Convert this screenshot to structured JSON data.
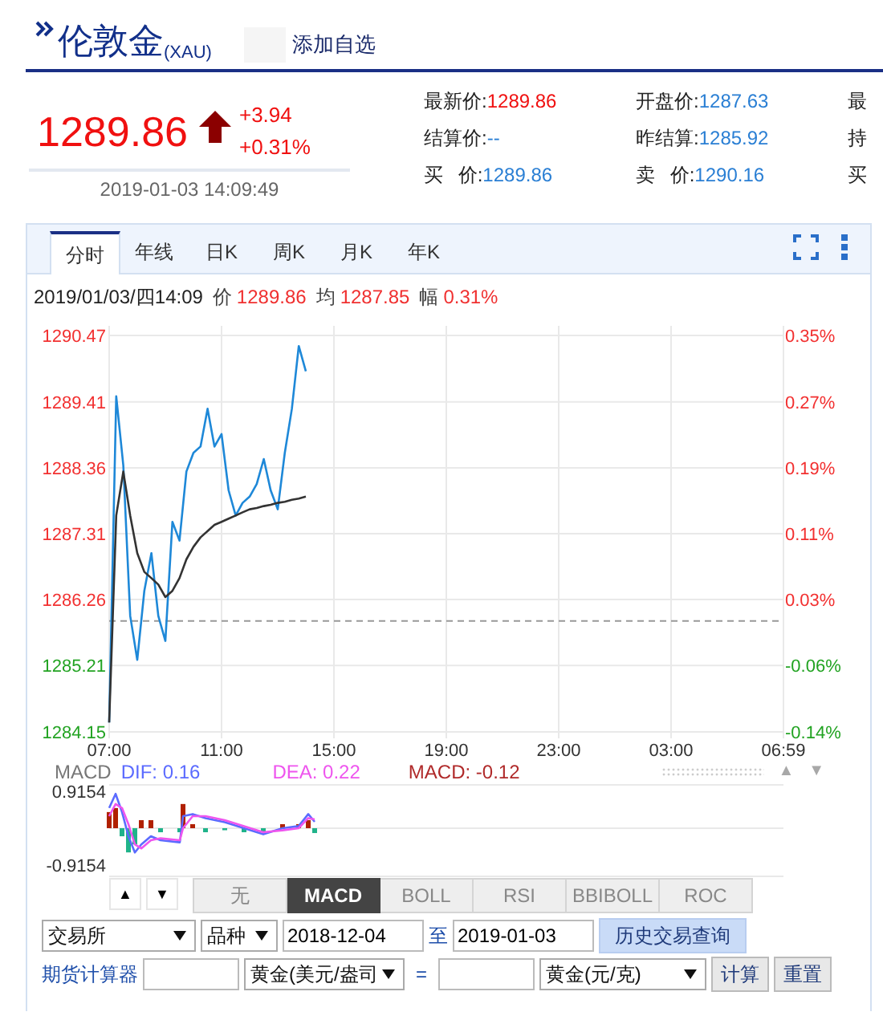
{
  "header": {
    "title": "伦敦金",
    "code": "(XAU)",
    "watch_button": "添加自选"
  },
  "price": {
    "value": "1289.86",
    "rising": true,
    "change": "+3.94",
    "change_pct": "+0.31%",
    "time": "2019-01-03 14:09:49"
  },
  "quotes": [
    [
      {
        "label": "最新价:",
        "value": "1289.86",
        "highlight": true
      },
      {
        "label": "开盘价:",
        "value": "1287.63",
        "highlight": false
      },
      {
        "label": "最"
      }
    ],
    [
      {
        "label": "结算价:",
        "value": "--",
        "highlight": false
      },
      {
        "label": "昨结算:",
        "value": "1285.92",
        "highlight": false
      },
      {
        "label": "持"
      }
    ],
    [
      {
        "label": "买 价:",
        "value": "1289.86",
        "highlight": false
      },
      {
        "label": "卖 价:",
        "value": "1290.16",
        "highlight": false
      },
      {
        "label": "买"
      }
    ]
  ],
  "chart_panel": {
    "tabs": [
      {
        "label": "分时",
        "selected": true
      },
      {
        "label": "年线",
        "selected": false
      },
      {
        "label": "日K",
        "selected": false
      },
      {
        "label": "周K",
        "selected": false
      },
      {
        "label": "月K",
        "selected": false
      },
      {
        "label": "年K",
        "selected": false
      }
    ],
    "info": {
      "time": "2019/01/03/四14:09",
      "items": [
        {
          "label": "价",
          "value": "1289.86"
        },
        {
          "label": "均",
          "value": "1287.85"
        },
        {
          "label": "幅",
          "value": "0.31%"
        }
      ]
    },
    "chart_data": {
      "type": "line",
      "categories": [
        "07:00",
        null,
        null,
        null,
        null,
        null,
        null,
        null,
        null,
        null,
        null,
        null,
        null,
        null,
        null,
        null,
        "11:00",
        null,
        null,
        null,
        null,
        null,
        null,
        null,
        null,
        null,
        null,
        null,
        null,
        null,
        null,
        null,
        "15:00",
        null,
        null,
        null,
        null,
        null,
        null,
        null,
        null,
        null,
        null,
        null,
        null,
        null,
        null,
        null,
        "19:00",
        null,
        null,
        null,
        null,
        null,
        null,
        null,
        null,
        null,
        null,
        null,
        null,
        null,
        null,
        null,
        "23:00",
        null,
        null,
        null,
        null,
        null,
        null,
        null,
        null,
        null,
        null,
        null,
        null,
        null,
        null,
        null,
        "03:00",
        null,
        null,
        null,
        null,
        null,
        null,
        null,
        null,
        null,
        null,
        null,
        null,
        null,
        null,
        null,
        "06:59"
      ],
      "series": [
        {
          "color": "#1e88d8",
          "values": [
            1284.3,
            1289.5,
            1288.4,
            1286.0,
            1285.3,
            1286.4,
            1287.0,
            1286.0,
            1285.6,
            1287.5,
            1287.2,
            1288.3,
            1288.6,
            1288.7,
            1289.3,
            1288.7,
            1288.9,
            1288.0,
            1287.6,
            1287.8,
            1287.9,
            1288.1,
            1288.5,
            1288.0,
            1287.7,
            1288.6,
            1289.3,
            1290.3,
            1289.9,
            null,
            null,
            null,
            null,
            null,
            null,
            null,
            null,
            null,
            null,
            null,
            null,
            null,
            null,
            null,
            null,
            null,
            null,
            null,
            null,
            null,
            null,
            null,
            null,
            null,
            null,
            null,
            null,
            null,
            null,
            null,
            null,
            null,
            null,
            null,
            null,
            null,
            null,
            null,
            null,
            null,
            null,
            null,
            null,
            null,
            null,
            null,
            null,
            null,
            null,
            null,
            null,
            null,
            null,
            null,
            null,
            null,
            null,
            null,
            null,
            null,
            null,
            null,
            null,
            null,
            null,
            null,
            null
          ]
        },
        {
          "color": "#333333",
          "values": [
            1284.3,
            1287.6,
            1288.3,
            1287.6,
            1287.0,
            1286.7,
            1286.6,
            1286.5,
            1286.3,
            1286.4,
            1286.6,
            1286.9,
            1287.1,
            1287.25,
            1287.35,
            1287.45,
            1287.5,
            1287.55,
            1287.6,
            1287.65,
            1287.7,
            1287.72,
            1287.75,
            1287.77,
            1287.8,
            1287.82,
            1287.85,
            1287.87,
            1287.9,
            null,
            null,
            null,
            null,
            null,
            null,
            null,
            null,
            null,
            null,
            null,
            null,
            null,
            null,
            null,
            null,
            null,
            null,
            null,
            null,
            null,
            null,
            null,
            null,
            null,
            null,
            null,
            null,
            null,
            null,
            null,
            null,
            null,
            null,
            null,
            null,
            null,
            null,
            null,
            null,
            null,
            null,
            null,
            null,
            null,
            null,
            null,
            null,
            null,
            null,
            null,
            null,
            null,
            null,
            null,
            null,
            null,
            null,
            null,
            null,
            null,
            null,
            null,
            null,
            null,
            null,
            null,
            null
          ]
        }
      ],
      "grid": true,
      "ylim": [
        1284.15,
        1290.47
      ],
      "y2lim": [
        -0.1376,
        0.3538
      ],
      "yticks": [
        1284.15,
        1285.21,
        1286.26,
        1287.31,
        1288.36,
        1289.41,
        1290.47
      ],
      "y2ticks": [
        {
          "value": -0.1376,
          "label": "-0.14%"
        },
        {
          "value": -0.0552,
          "label": "-0.06%"
        },
        {
          "value": 0.0264,
          "label": "0.03%"
        },
        {
          "value": 0.1081,
          "label": "0.11%"
        },
        {
          "value": 0.1897,
          "label": "0.19%"
        },
        {
          "value": 0.2714,
          "label": "0.27%"
        },
        {
          "value": 0.3538,
          "label": "0.35%"
        }
      ],
      "ref_lines": [
        {
          "axis": "y",
          "value": 1285.92
        }
      ]
    },
    "macd": {
      "title": "MACD",
      "legend": [
        {
          "text": "DIF: 0.16",
          "color": "#5b6bff"
        },
        {
          "text": "DEA: 0.22",
          "color": "#ee55ee"
        },
        {
          "text": "MACD: -0.12",
          "color": "#b02a2a"
        }
      ],
      "arrows": [
        {
          "text": "▲",
          "disabled": true
        },
        {
          "text": "▼",
          "disabled": true
        }
      ],
      "scale_labels": [
        "0.9154",
        "-0.9154"
      ]
    },
    "scroll_buttons": [
      "▲",
      "▼"
    ],
    "indicator_tabs": [
      {
        "label": "无",
        "selected": false
      },
      {
        "label": "MACD",
        "selected": true
      },
      {
        "label": "BOLL",
        "selected": false
      },
      {
        "label": "RSI",
        "selected": false
      },
      {
        "label": "BBIBOLL",
        "selected": false
      },
      {
        "label": "ROC",
        "selected": false
      }
    ]
  },
  "history_query": {
    "exchange": "交易所",
    "variety": "品种",
    "from": "2018-12-04",
    "to_label": "至",
    "to": "2019-01-03",
    "button": "历史交易查询"
  },
  "calculator": {
    "label": "期货计算器",
    "from_unit": "黄金(美元/盎司",
    "equals": "=",
    "to_unit": "黄金(元/克)",
    "buttons": [
      "计算",
      "重置"
    ]
  }
}
